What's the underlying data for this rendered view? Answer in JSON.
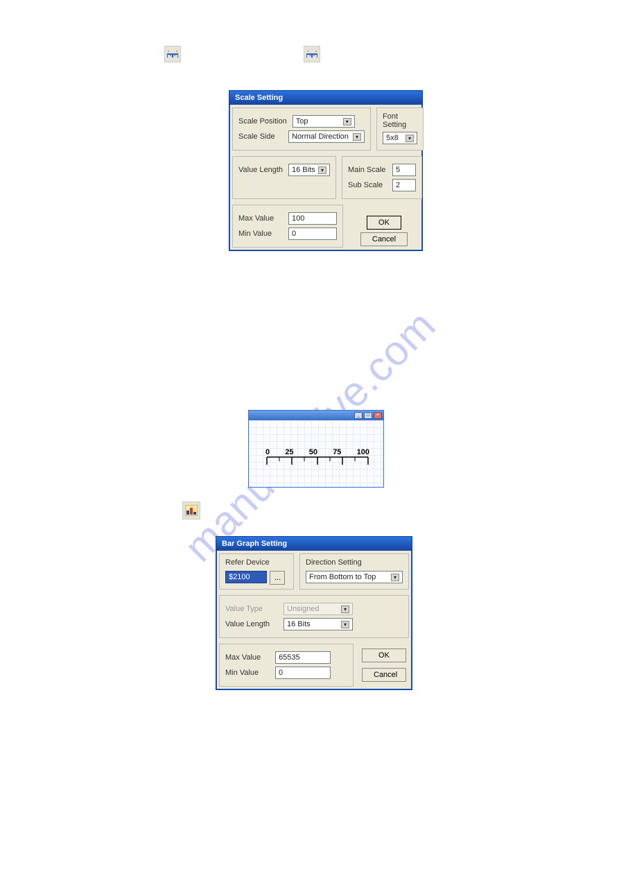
{
  "watermark": "manualshive.com",
  "scale_dialog": {
    "title": "Scale Setting",
    "scale_position_label": "Scale Position",
    "scale_position_value": "Top",
    "scale_side_label": "Scale Side",
    "scale_side_value": "Normal Direction",
    "font_setting_label": "Font Setting",
    "font_setting_value": "5x8",
    "value_length_label": "Value Length",
    "value_length_value": "16 Bits",
    "max_value_label": "Max Value",
    "max_value": "100",
    "min_value_label": "Min Value",
    "min_value": "0",
    "main_scale_label": "Main Scale",
    "main_scale": "5",
    "sub_scale_label": "Sub Scale",
    "sub_scale": "2",
    "ok_label": "OK",
    "cancel_label": "Cancel"
  },
  "scale_preview": {
    "ticks": [
      "0",
      "25",
      "50",
      "75",
      "100"
    ]
  },
  "bar_dialog": {
    "title": "Bar Graph Setting",
    "refer_device_label": "Refer Device",
    "refer_device_value": "$2100",
    "browse_label": "...",
    "direction_label": "Direction Setting",
    "direction_value": "From Bottom to Top",
    "value_type_label": "Value Type",
    "value_type_value": "Unsigned",
    "value_length_label": "Value Length",
    "value_length_value": "16 Bits",
    "max_value_label": "Max Value",
    "max_value": "65535",
    "min_value_label": "Min Value",
    "min_value": "0",
    "ok_label": "OK",
    "cancel_label": "Cancel"
  }
}
